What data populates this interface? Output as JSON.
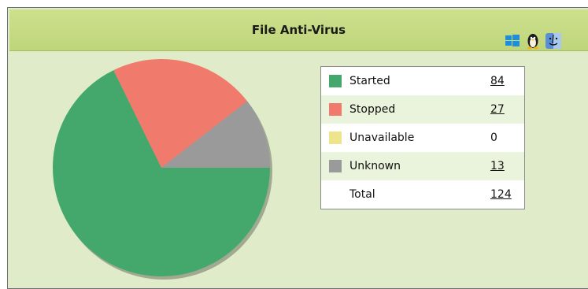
{
  "widget": {
    "title": "File Anti-Virus",
    "os_icons": [
      "windows-icon",
      "linux-icon",
      "mac-icon"
    ]
  },
  "chart_data": {
    "type": "pie",
    "categories": [
      "Started",
      "Stopped",
      "Unavailable",
      "Unknown"
    ],
    "values": [
      84,
      27,
      0,
      13
    ],
    "total": 124,
    "colors": [
      "#44a86c",
      "#f07b6c",
      "#ede48c",
      "#9a9a9a"
    ]
  },
  "legend": {
    "rows": [
      {
        "label": "Started",
        "value": "84",
        "color": "#44a86c",
        "link": true
      },
      {
        "label": "Stopped",
        "value": "27",
        "color": "#f07b6c",
        "link": true
      },
      {
        "label": "Unavailable",
        "value": "0",
        "color": "#ede48c",
        "link": false
      },
      {
        "label": "Unknown",
        "value": "13",
        "color": "#9a9a9a",
        "link": true
      }
    ],
    "total_label": "Total",
    "total_value": "124"
  }
}
